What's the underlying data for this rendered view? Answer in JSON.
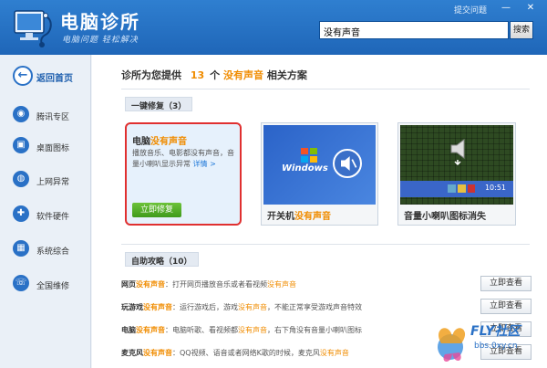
{
  "app": {
    "title": "电脑诊所",
    "slogan": "电脑问题 轻松解决",
    "submit_issue": "提交问题",
    "window_controls": [
      "—",
      "✕"
    ]
  },
  "search": {
    "value": "没有声音",
    "button": "搜索"
  },
  "sidebar": {
    "items": [
      {
        "label": "返回首页",
        "icon": "back-arrow-icon",
        "glyph": "←"
      },
      {
        "label": "腾讯专区",
        "icon": "penguin-icon",
        "glyph": "◉"
      },
      {
        "label": "桌面图标",
        "icon": "monitor-icon",
        "glyph": "▣"
      },
      {
        "label": "上网异常",
        "icon": "globe-icon",
        "glyph": "◍"
      },
      {
        "label": "软件硬件",
        "icon": "gamepad-icon",
        "glyph": "✚"
      },
      {
        "label": "系统综合",
        "icon": "windows-icon",
        "glyph": "▦"
      },
      {
        "label": "全国维修",
        "icon": "phone-icon",
        "glyph": "☏"
      }
    ]
  },
  "headline": {
    "prefix": "诊所为您提供",
    "count": "13",
    "mid": "个",
    "keyword": "没有声音",
    "suffix": "相关方案"
  },
  "one_click": {
    "section_label": "一键修复（3）",
    "card1": {
      "title_a": "电脑",
      "title_b": "没有声音",
      "desc": "播放音乐、电影都没有声音，音量小喇叭显示异常",
      "more": "详情 >",
      "button": "立即修复"
    },
    "card2": {
      "caption_a": "开关机",
      "caption_b": "没有声音",
      "thumb_text": "Windows"
    },
    "card3": {
      "caption": "音量小喇叭图标消失",
      "time": "10:51"
    }
  },
  "self_help": {
    "section_label": "自助攻略（10）",
    "items": [
      {
        "title_a": "网页",
        "title_b": "没有声音",
        "desc_a": "：打开网页播放音乐或者看视频",
        "desc_b": "没有声音",
        "desc_c": "",
        "button": "立即查看"
      },
      {
        "title_a": "玩游戏",
        "title_b": "没有声音",
        "desc_a": "：运行游戏后，游戏",
        "desc_b": "没有声音",
        "desc_c": "，不能正常享受游戏声音特效",
        "button": "立即查看"
      },
      {
        "title_a": "电脑",
        "title_b": "没有声音",
        "desc_a": "：电脑听歌、看视频都",
        "desc_b": "没有声音",
        "desc_c": "，右下角没有音量小喇叭图标",
        "button": "立即查看"
      },
      {
        "title_a": "麦克风",
        "title_b": "没有声音",
        "desc_a": "：QQ视频、语音或者网络K歌的时候，麦克风",
        "desc_b": "没有声音",
        "desc_c": "",
        "button": "立即查看"
      }
    ]
  },
  "watermark": {
    "text": "FLY社区",
    "url": "bbs.0xy.cn"
  },
  "colors": {
    "header": "#2f7fd0",
    "accent": "#f08c00",
    "fix_green": "#4fae25",
    "card_border": "#e03030"
  }
}
